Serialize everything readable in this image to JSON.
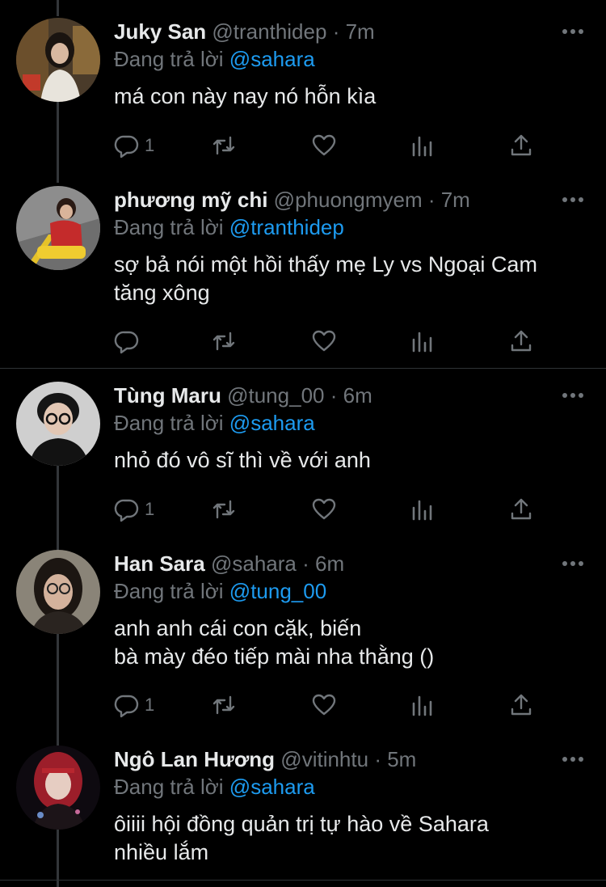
{
  "reply_prefix": "Đang trả lời",
  "colors": {
    "background": "#000000",
    "text": "#e7e9ea",
    "muted": "#71767b",
    "mention": "#1d9bf0"
  },
  "tweets": [
    {
      "name": "Juky San",
      "handle": "@tranthidep",
      "time": "· 7m",
      "reply_to": "@sahara",
      "text": [
        "má con này nay nó hỗn kìa"
      ],
      "reply_count": "1"
    },
    {
      "name": "phương mỹ chi",
      "handle": "@phuongmyem",
      "time": "· 7m",
      "reply_to": "@tranthidep",
      "text": [
        "sợ bả nói một hồi thấy mẹ Ly vs Ngoại Cam",
        "tăng xông"
      ],
      "reply_count": ""
    },
    {
      "name": "Tùng Maru",
      "handle": "@tung_00",
      "time": "· 6m",
      "reply_to": "@sahara",
      "text": [
        "nhỏ đó vô sĩ thì về với anh"
      ],
      "reply_count": "1"
    },
    {
      "name": "Han Sara",
      "handle": "@sahara",
      "time": "· 6m",
      "reply_to": "@tung_00",
      "text": [
        "anh anh cái con cặk, biến",
        "bà mày đéo tiếp mài nha thằng ()"
      ],
      "reply_count": "1"
    },
    {
      "name": "Ngô Lan Hương",
      "handle": "@vitinhtu",
      "time": "· 5m",
      "reply_to": "@sahara",
      "text": [
        "ôiiii hội đồng quản trị tự hào về Sahara",
        "nhiều lắm"
      ],
      "reply_count": ""
    }
  ],
  "icons": [
    "more-icon",
    "reply-icon",
    "retweet-icon",
    "like-icon",
    "views-icon",
    "share-icon"
  ]
}
